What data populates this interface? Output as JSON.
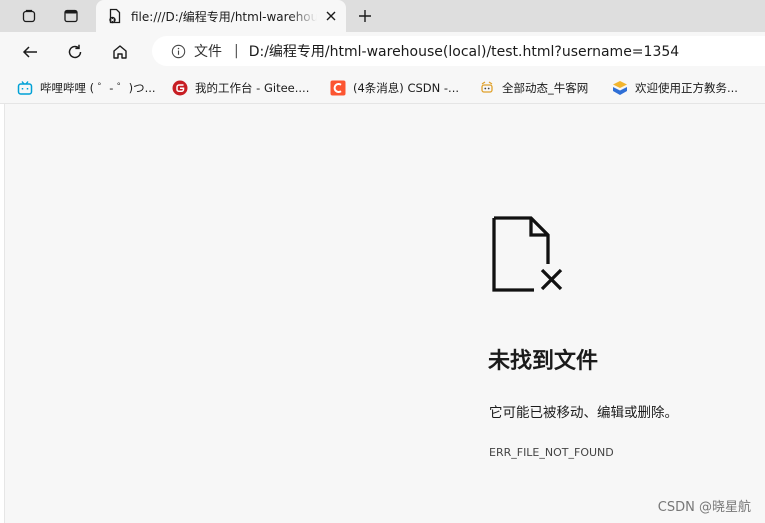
{
  "browser": {
    "tab": {
      "title": "file:///D:/编程专用/html-warehouse(local)/test.html?username=1354"
    },
    "address_bar": {
      "site_label": "文件",
      "separator": "|",
      "url": "D:/编程专用/html-warehouse(local)/test.html?username=1354"
    },
    "bookmarks": [
      {
        "label": "哔哩哔哩 ( ゜- ゜)つ...",
        "icon": "bilibili-icon",
        "color": "#00a1d6"
      },
      {
        "label": "我的工作台 - Gitee....",
        "icon": "gitee-icon",
        "color": "#c71d23"
      },
      {
        "label": "(4条消息) CSDN -...",
        "icon": "csdn-icon",
        "color": "#fc5531"
      },
      {
        "label": "全部动态_牛客网",
        "icon": "nowcoder-icon",
        "color": "#e0a12b"
      },
      {
        "label": "欢迎使用正方教务...",
        "icon": "zhengfang-icon",
        "color": "#2f6fd6"
      }
    ]
  },
  "error_page": {
    "icon": "file-not-found-icon",
    "title": "未找到文件",
    "description": "它可能已被移动、编辑或删除。",
    "code": "ERR_FILE_NOT_FOUND"
  },
  "watermark": "CSDN @晓星航"
}
